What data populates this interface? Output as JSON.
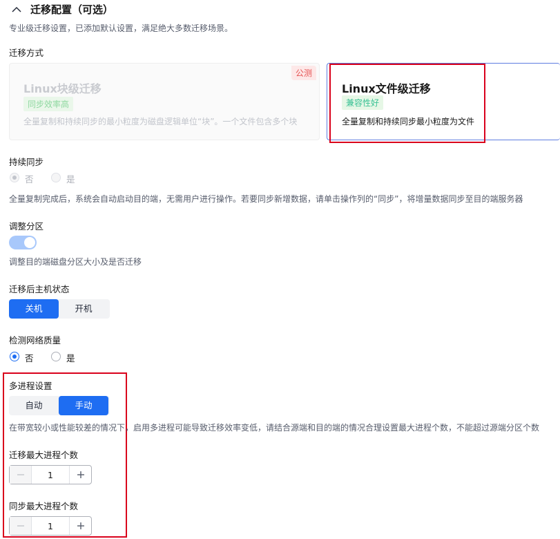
{
  "section": {
    "title": "迁移配置（可选）",
    "desc": "专业级迁移设置，已添加默认设置，满足绝大多数迁移场景。"
  },
  "mode": {
    "label": "迁移方式",
    "card1": {
      "title": "Linux块级迁移",
      "tag": "同步效率高",
      "desc": "全量复制和持续同步的最小粒度为磁盘逻辑单位“块”。一个文件包含多个块",
      "badge": "公测"
    },
    "card2": {
      "title": "Linux文件级迁移",
      "tag": "兼容性好",
      "desc": "全量复制和持续同步最小粒度为文件"
    }
  },
  "sync": {
    "label": "持续同步",
    "opt_no": "否",
    "opt_yes": "是",
    "desc": "全量复制完成后，系统会自动启动目的端，无需用户进行操作。若要同步新增数据，请单击操作列的“同步”，将增量数据同步至目的端服务器"
  },
  "partition": {
    "label": "调整分区",
    "desc": "调整目的端磁盘分区大小及是否迁移"
  },
  "host_state": {
    "label": "迁移后主机状态",
    "off": "关机",
    "on": "开机"
  },
  "network": {
    "label": "检测网络质量",
    "opt_no": "否",
    "opt_yes": "是"
  },
  "multiproc": {
    "label": "多进程设置",
    "auto": "自动",
    "manual": "手动",
    "desc": "在带宽较小或性能较差的情况下，启用多进程可能导致迁移效率变低，请结合源端和目的端的情况合理设置最大进程个数，不能超过源端分区个数",
    "migrate_label": "迁移最大进程个数",
    "migrate_value": "1",
    "sync_label": "同步最大进程个数",
    "sync_value": "1"
  }
}
